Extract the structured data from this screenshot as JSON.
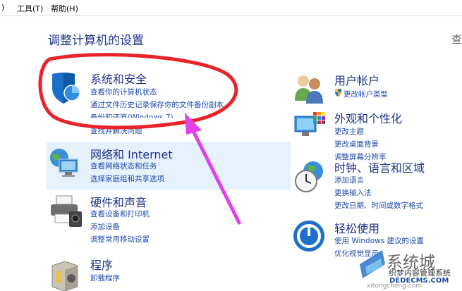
{
  "menubar": {
    "view_fragment": ")",
    "tools": "工具(T)",
    "help": "帮助(H)"
  },
  "page": {
    "title": "调整计算机的设置",
    "cut_link": "查"
  },
  "categories": {
    "system_security": {
      "title": "系统和安全",
      "links": [
        "查看你的计算机状态",
        "通过文件历史记录保存你的文件备份副本",
        "备份和还原(Windows 7)",
        "查找并解决问题"
      ]
    },
    "network": {
      "title": "网络和 Internet",
      "links": [
        "查看网络状态和任务",
        "选择家庭组和共享选项"
      ]
    },
    "hardware": {
      "title": "硬件和声音",
      "links": [
        "查看设备和打印机",
        "添加设备",
        "调整常用移动设置"
      ]
    },
    "programs": {
      "title": "程序",
      "links": [
        "卸载程序"
      ]
    },
    "user_accounts": {
      "title": "用户帐户",
      "links": [
        "更改帐户类型"
      ]
    },
    "appearance": {
      "title": "外观和个性化",
      "links": [
        "更改主题",
        "更改桌面背景",
        "调整屏幕分辨率"
      ]
    },
    "clock": {
      "title": "时钟、语言和区域",
      "links": [
        "添加语言",
        "更换输入法",
        "更改日期、时间或数字格式"
      ]
    },
    "ease": {
      "title": "轻松使用",
      "links": [
        "使用 Windows 建议的设置",
        "优化视觉显示"
      ]
    }
  },
  "watermark": {
    "name": "系统城",
    "line1": "织梦内容管理系统",
    "line2": "DEDECMS.COM",
    "line3": "xitongcheng.com"
  },
  "colors": {
    "title_blue": "#1e3287",
    "link_blue": "#1f4aa8",
    "highlight": "#e5f1fb",
    "annotation": "#e8232a",
    "arrow": "#e040e8"
  }
}
